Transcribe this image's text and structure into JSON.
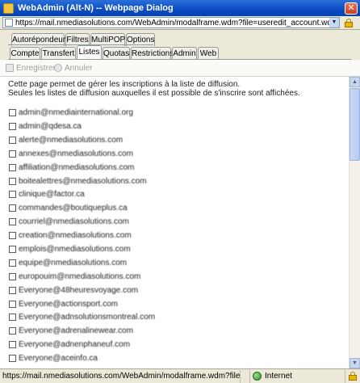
{
  "window": {
    "title": "WebAdmin (Alt-N) -- Webpage Dialog",
    "close_glyph": "✕"
  },
  "address": {
    "url": "https://mail.nmediasolutions.com/WebAdmin/modalframe.wdm?file=useredit_account.wdm"
  },
  "tabs": {
    "row1": [
      "Autorépondeur",
      "Filtres",
      "MultiPOP",
      "Options"
    ],
    "row2": [
      "Compte",
      "Transfert",
      "Listes",
      "Quotas",
      "Restrictions",
      "Admin",
      "Web"
    ],
    "active": "Listes"
  },
  "toolbar": {
    "save_label": "Enregistrer",
    "cancel_label": "Annuler"
  },
  "panel": {
    "line1": "Cette page permet de gérer les inscriptions à la liste de diffusion.",
    "line2": "Seules les listes de diffusion auxquelles il est possible de s'inscrire sont affichées."
  },
  "lists": [
    "admin@nmediainternational.org",
    "admin@qdesa.ca",
    "alerte@nmediasolutions.com",
    "annexes@nmediasolutions.com",
    "affiliation@nmediasolutions.com",
    "boitealettres@nmediasolutions.com",
    "clinique@factor.ca",
    "commandes@boutiqueplus.ca",
    "courriel@nmediasolutions.com",
    "creation@nmediasolutions.com",
    "emplois@nmediasolutions.com",
    "equipe@nmediasolutions.com",
    "europouim@nmediasolutions.com",
    "Everyone@48heuresvoyage.com",
    "Everyone@actionsport.com",
    "Everyone@adnsolutionsmontreal.com",
    "Everyone@adrenalinewear.com",
    "Everyone@adnenphaneuf.com",
    "Everyone@aceinfo.ca"
  ],
  "status": {
    "url": "https://mail.nmediasolutions.com/WebAdmin/modalframe.wdm?file=useredit_account.wdm",
    "zone": "Internet"
  },
  "colors": {
    "titlebar": "#0a4bc4",
    "chrome": "#ece9d8",
    "tab_border": "#919b9c"
  }
}
